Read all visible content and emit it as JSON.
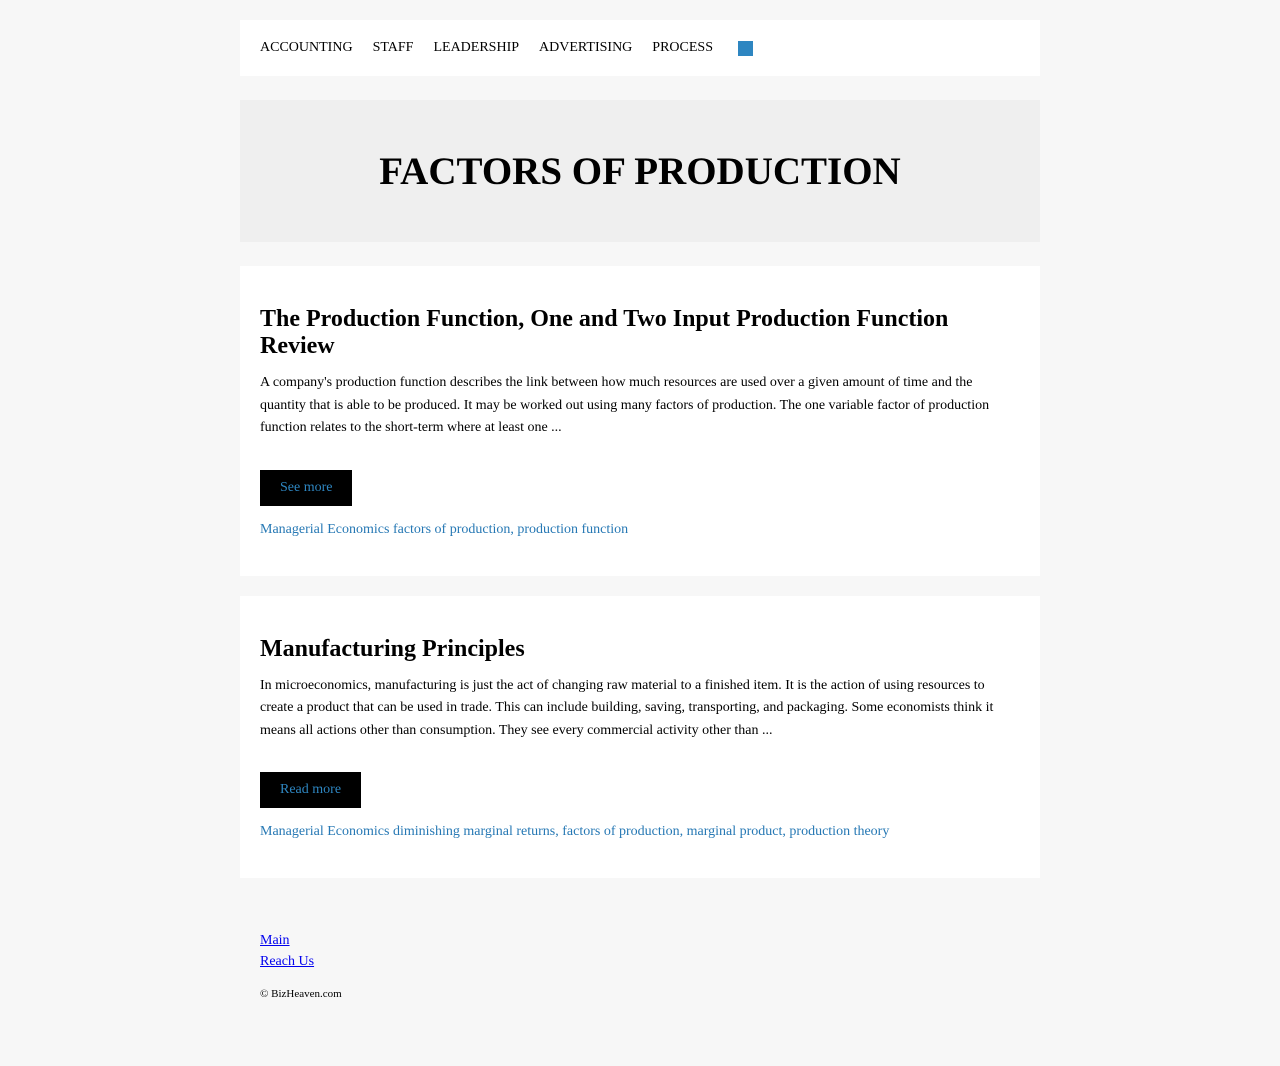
{
  "nav": {
    "items": [
      "ACCOUNTING",
      "STAFF",
      "LEADERSHIP",
      "ADVERTISING",
      "PROCESS"
    ],
    "accent_color": "#2e86c1",
    "menu_icon": "square-icon"
  },
  "hero": {
    "title": "FACTORS OF PRODUCTION"
  },
  "posts": [
    {
      "title": "The Production Function, One and Two Input Production Function Review",
      "excerpt": "A company's production function describes the link between how much resources are used over a given amount of time and the quantity that is able to be produced. It may be worked out using many factors of production. The one variable factor of production function relates to the short-term where at least one ...",
      "button_label": "See more",
      "category": "Managerial Economics",
      "tags": "factors of production, production function"
    },
    {
      "title": "Manufacturing Principles",
      "excerpt": "In microeconomics, manufacturing is just the act of changing raw material to a finished item. It is the action of using resources to create a product that can be used in trade. This can include building, saving, transporting, and packaging. Some economists think it means all actions other than consumption. They see every commercial activity other than ...",
      "button_label": "Read more",
      "category": "Managerial Economics",
      "tags": "diminishing marginal returns, factors of production, marginal product, production theory"
    }
  ],
  "footer": {
    "links": [
      "Main",
      "Reach Us"
    ],
    "copyright": "© BizHeaven.com"
  }
}
